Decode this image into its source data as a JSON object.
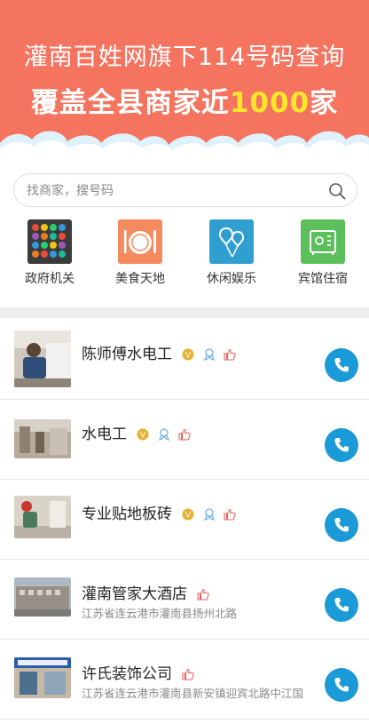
{
  "banner": {
    "line1": "灌南百姓网旗下114号码查询",
    "line2_prefix": "覆盖全县商家近",
    "line2_highlight": "1000",
    "line2_suffix": "家",
    "bg_color": "#f47460",
    "highlight_color": "#ffe62a"
  },
  "search": {
    "placeholder": "找商家，搜号码",
    "icon": "search-icon"
  },
  "categories": [
    {
      "label": "政府机关",
      "icon": "government-grid-icon",
      "color": "#3b3b3b"
    },
    {
      "label": "美食天地",
      "icon": "dining-plate-icon",
      "color": "#f48a5e"
    },
    {
      "label": "休闲娱乐",
      "icon": "balloons-icon",
      "color": "#2f9fcf"
    },
    {
      "label": "宾馆住宿",
      "icon": "hotel-safe-icon",
      "color": "#5bbf5b"
    }
  ],
  "listings": [
    {
      "name": "陈师傅水电工",
      "address": "",
      "badges": [
        "vip-badge-icon",
        "verified-badge-icon",
        "thumbs-up-icon"
      ]
    },
    {
      "name": "水电工",
      "address": "",
      "badges": [
        "vip-badge-icon",
        "verified-badge-icon",
        "thumbs-up-icon"
      ]
    },
    {
      "name": "专业贴地板砖",
      "address": "",
      "badges": [
        "vip-badge-icon",
        "verified-badge-icon",
        "thumbs-up-icon"
      ]
    },
    {
      "name": "灌南管家大酒店",
      "address": "江苏省连云港市灌南县扬州北路",
      "badges": [
        "thumbs-up-icon"
      ]
    },
    {
      "name": "许氏装饰公司",
      "address": "江苏省连云港市灌南县新安镇迎宾北路中江国",
      "badges": [
        "thumbs-up-icon"
      ]
    }
  ],
  "call_button_color": "#1a9ad6"
}
